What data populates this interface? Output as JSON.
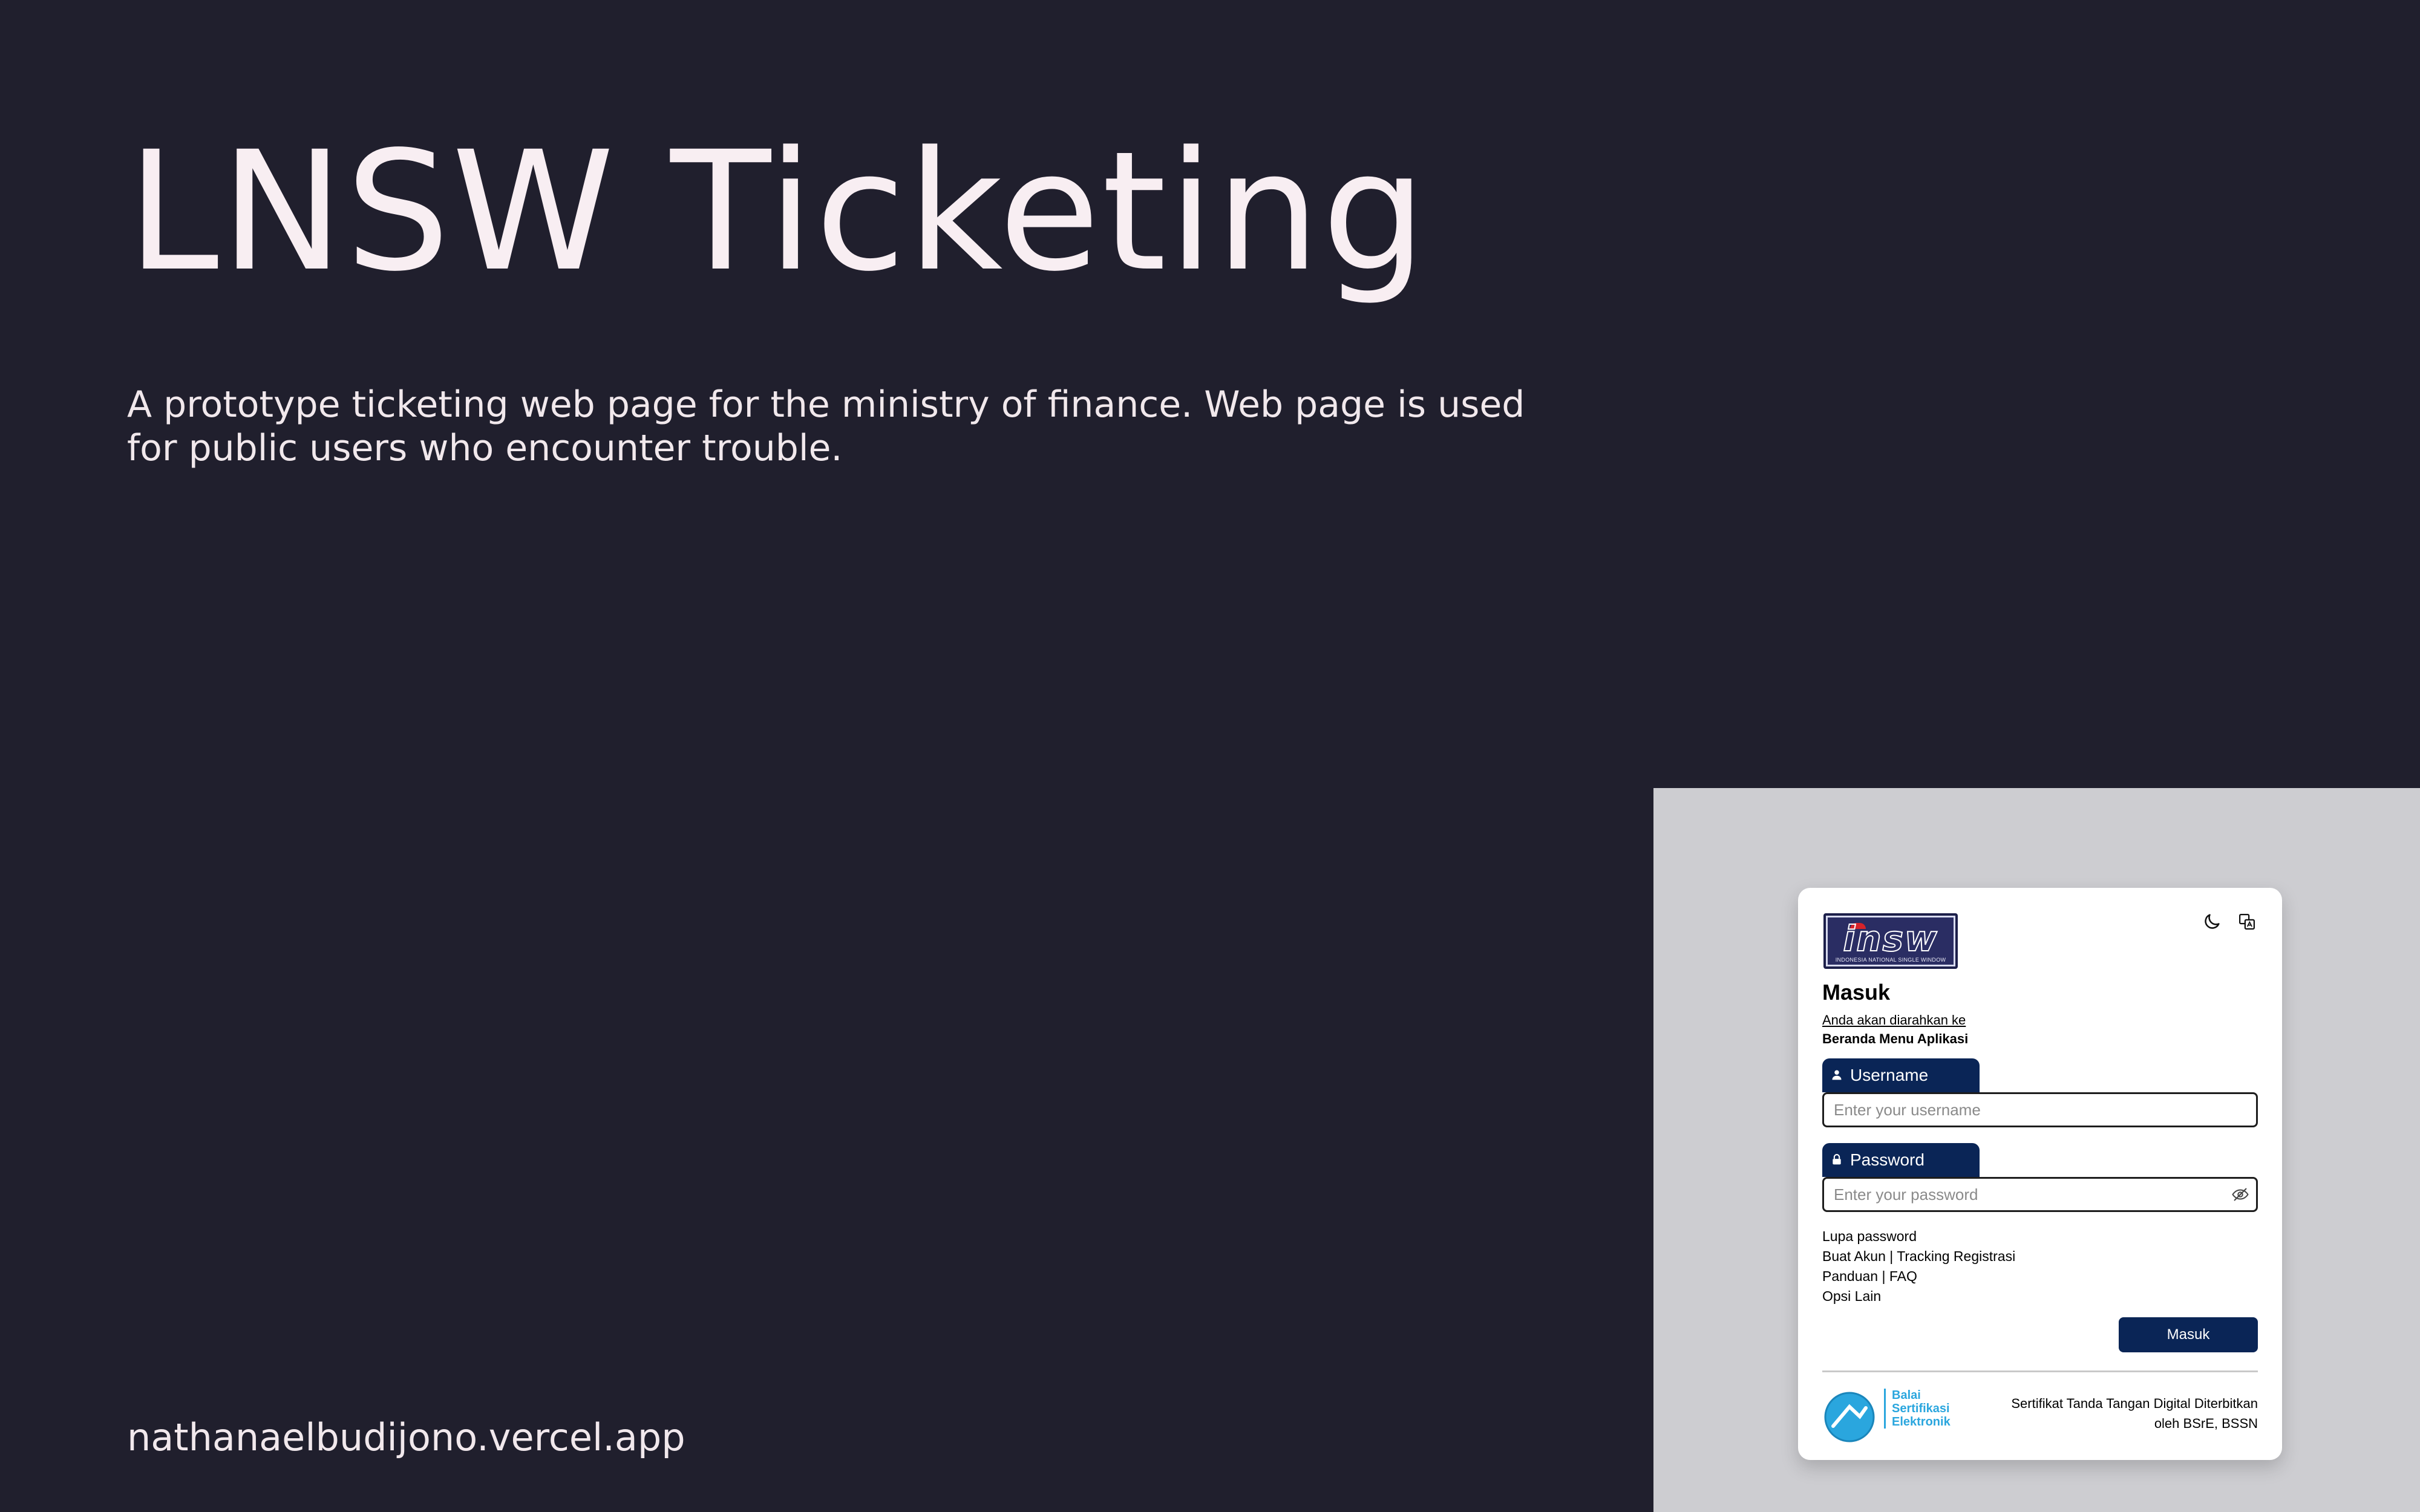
{
  "hero": {
    "title": "LNSW Ticketing",
    "description": "A prototype ticketing web page for the ministry of finance. Web page is used for public users who encounter trouble.",
    "url": "nathanaelbudijono.vercel.app"
  },
  "login_card": {
    "logo": {
      "main": "insw",
      "sub": "INDONESIA NATIONAL SINGLE WINDOW"
    },
    "icons": [
      "moon-icon",
      "translate-icon"
    ],
    "title": "Masuk",
    "redirect_line": "Anda akan diarahkan ke",
    "redirect_target": "Beranda Menu Aplikasi",
    "username": {
      "label": "Username",
      "placeholder": "Enter your username",
      "value": ""
    },
    "password": {
      "label": "Password",
      "placeholder": "Enter your password",
      "value": ""
    },
    "links": [
      "Lupa password",
      "Buat Akun | Tracking Registrasi",
      "Panduan | FAQ",
      "Opsi Lain"
    ],
    "submit_label": "Masuk",
    "footer": {
      "bsre_lines": [
        "Balai",
        "Sertifikasi",
        "Elektronik"
      ],
      "cert_line1": "Sertifikat Tanda Tangan Digital Diterbitkan",
      "cert_line2": "oleh BSrE, BSSN"
    }
  },
  "colors": {
    "background": "#201f2d",
    "hero_text": "#f8eef2",
    "panel": "#cdcdd1",
    "primary": "#0a2556",
    "bsre_blue": "#2aa6de"
  }
}
